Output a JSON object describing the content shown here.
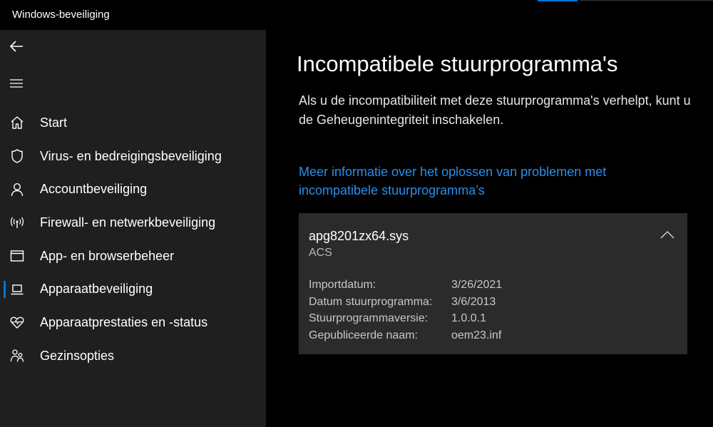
{
  "window": {
    "title": "Windows-beveiliging"
  },
  "sidebar": {
    "items": [
      {
        "label": "Start",
        "icon": "home-icon"
      },
      {
        "label": "Virus- en bedreigingsbeveiliging",
        "icon": "shield-icon"
      },
      {
        "label": "Accountbeveiliging",
        "icon": "person-icon"
      },
      {
        "label": "Firewall- en netwerkbeveiliging",
        "icon": "antenna-icon"
      },
      {
        "label": "App- en browserbeheer",
        "icon": "browser-window-icon"
      },
      {
        "label": "Apparaatbeveiliging",
        "icon": "laptop-icon",
        "selected": true
      },
      {
        "label": "Apparaatprestaties en -status",
        "icon": "heart-pulse-icon"
      },
      {
        "label": "Gezinsopties",
        "icon": "family-icon"
      }
    ]
  },
  "main": {
    "title": "Incompatibele stuurprogramma's",
    "description": "Als u de incompatibiliteit met deze stuurprogramma's verhelpt, kunt u de Geheugenintegriteit inschakelen.",
    "link": "Meer informatie over het oplossen van problemen met incompatibele stuurprogramma’s",
    "driver": {
      "name": "apg8201zx64.sys",
      "vendor": "ACS",
      "details": [
        {
          "label": "Importdatum:",
          "value": "3/26/2021"
        },
        {
          "label": "Datum stuurprogramma:",
          "value": "3/6/2013"
        },
        {
          "label": "Stuurprogrammaversie:",
          "value": "1.0.0.1"
        },
        {
          "label": "Gepubliceerde naam:",
          "value": "oem23.inf"
        }
      ]
    }
  },
  "colors": {
    "accent": "#0078d4",
    "link": "#2b8eea",
    "sidebar_bg": "#1f1f1f",
    "card_bg": "#2b2b2b"
  }
}
